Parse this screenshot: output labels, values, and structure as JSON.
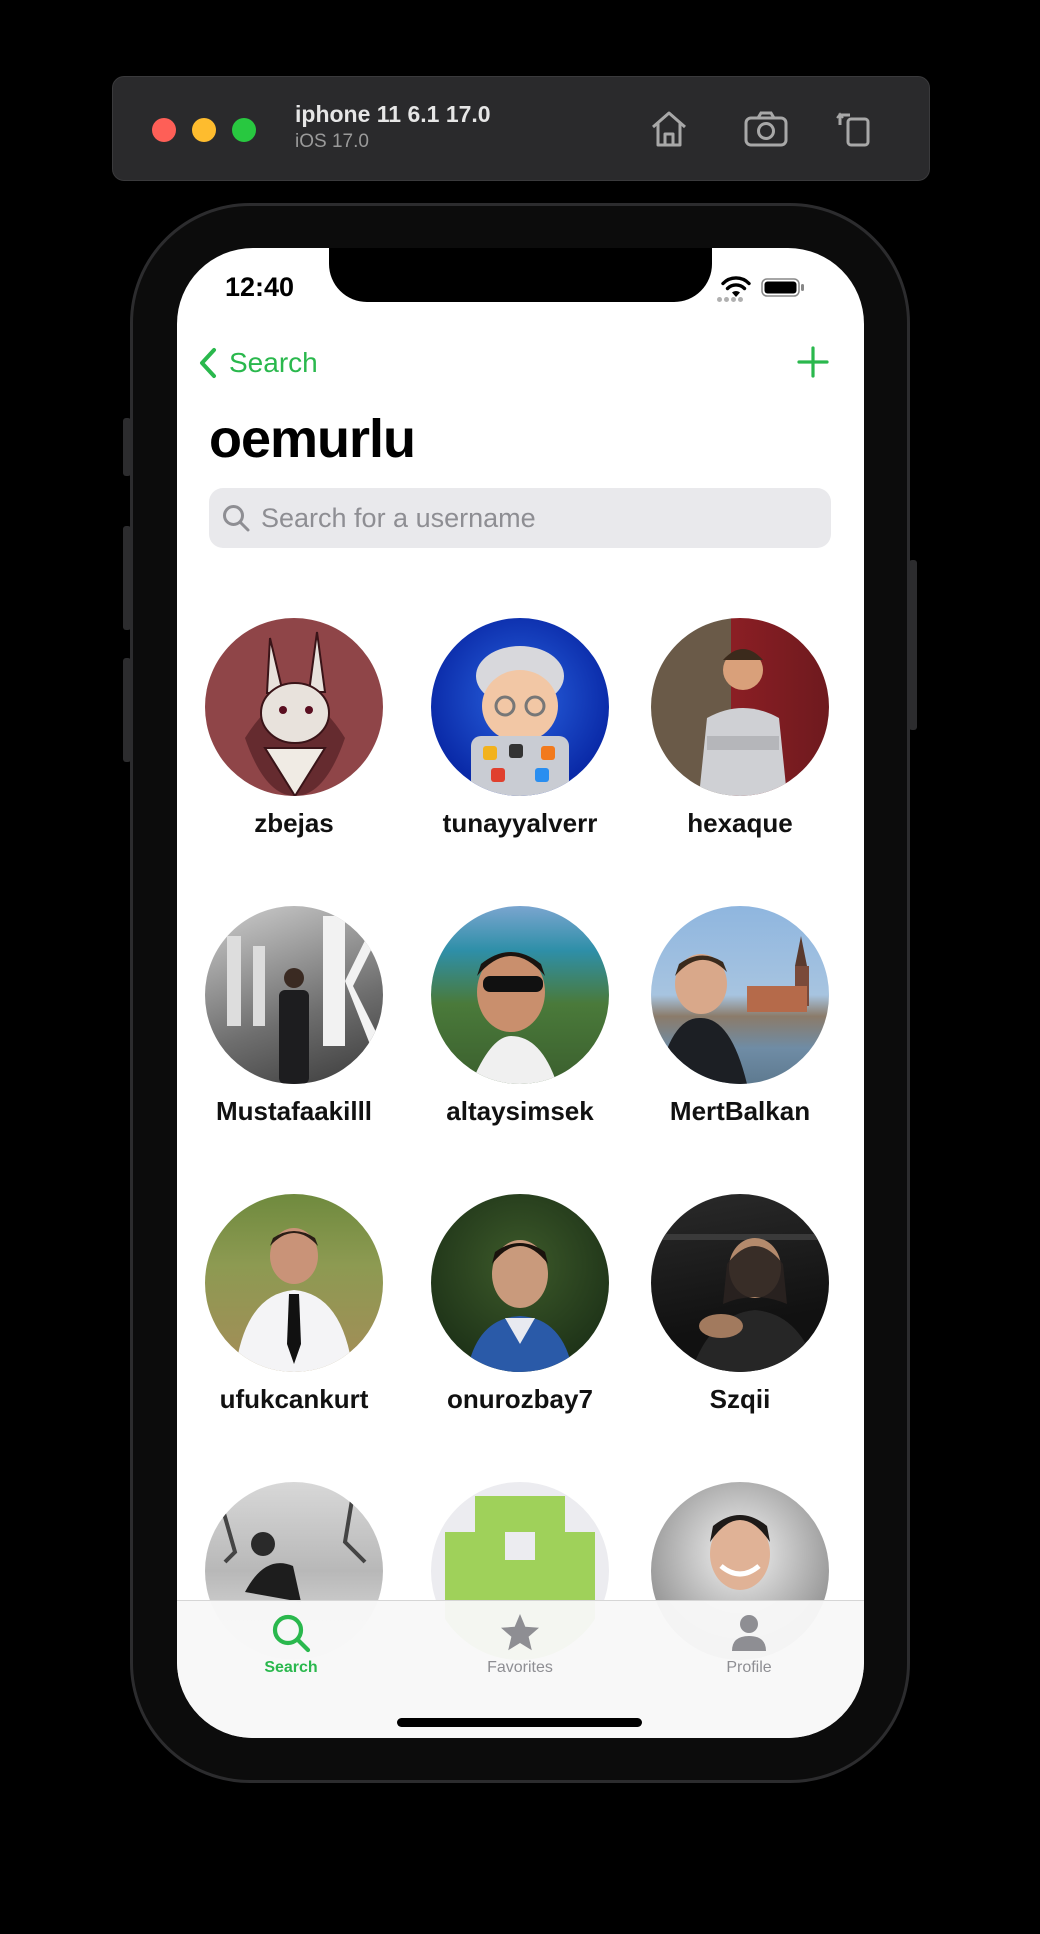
{
  "simulator": {
    "title": "iphone 11 6.1 17.0",
    "subtitle": "iOS 17.0",
    "buttons": [
      "home-icon",
      "screenshot-icon",
      "rotate-icon"
    ]
  },
  "status_bar": {
    "time": "12:40"
  },
  "nav": {
    "back_label": "Search",
    "add_icon": "plus-icon",
    "title": "oemurlu"
  },
  "search": {
    "placeholder": "Search for a username",
    "value": ""
  },
  "users": [
    {
      "name": "zbejas",
      "avatar": "illustrated-rabbit-avatar"
    },
    {
      "name": "tunayyalverr",
      "avatar": "memoji-avatar"
    },
    {
      "name": "hexaque",
      "avatar": "photo-avatar"
    },
    {
      "name": "Mustafaakilll",
      "avatar": "photo-avatar"
    },
    {
      "name": "altaysimsek",
      "avatar": "photo-avatar"
    },
    {
      "name": "MertBalkan",
      "avatar": "photo-avatar"
    },
    {
      "name": "ufukcankurt",
      "avatar": "photo-avatar"
    },
    {
      "name": "onurozbay7",
      "avatar": "photo-avatar"
    },
    {
      "name": "Szqii",
      "avatar": "photo-avatar"
    },
    {
      "name": "",
      "avatar": "photo-avatar"
    },
    {
      "name": "",
      "avatar": "pixel-invader-avatar"
    },
    {
      "name": "",
      "avatar": "photo-avatar"
    }
  ],
  "tabs": [
    {
      "label": "Search",
      "icon": "magnifier-icon",
      "active": true
    },
    {
      "label": "Favorites",
      "icon": "star-icon",
      "active": false
    },
    {
      "label": "Profile",
      "icon": "person-icon",
      "active": false
    }
  ],
  "colors": {
    "accent": "#2ab84d",
    "inactive_tab": "#8e8e93"
  }
}
